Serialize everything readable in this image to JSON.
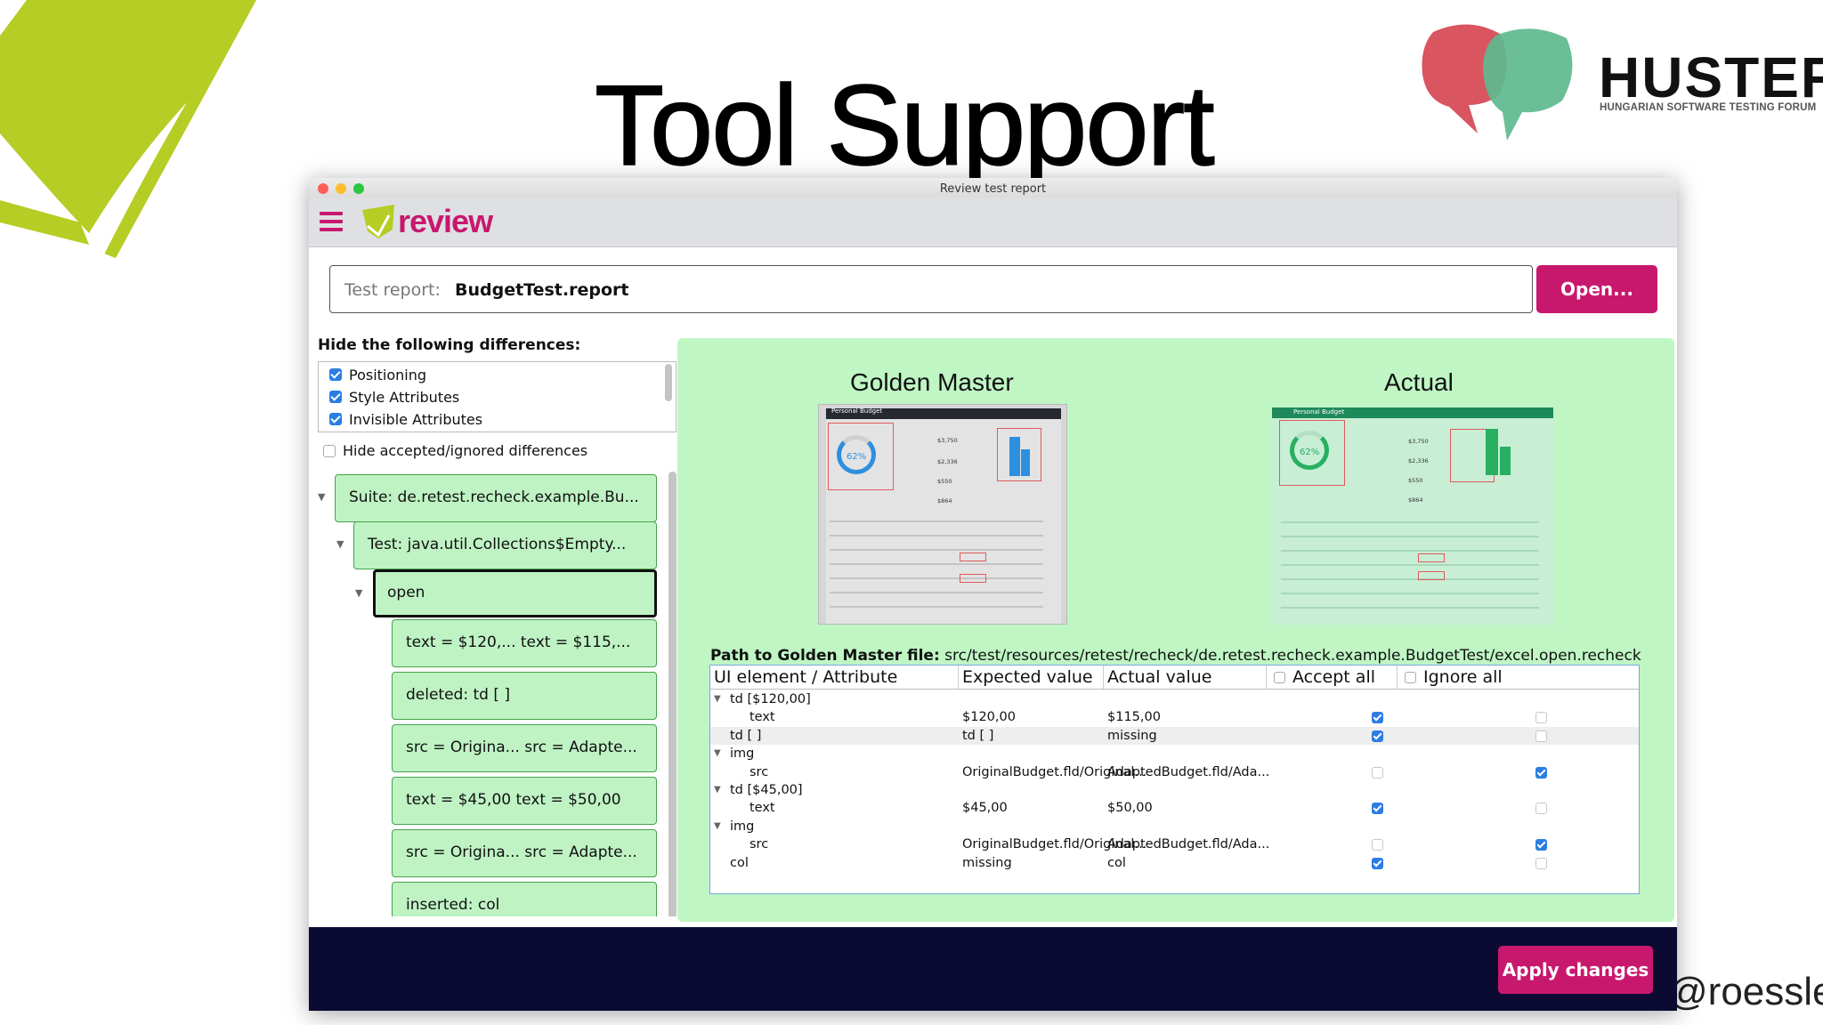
{
  "slide": {
    "title": "Tool Support",
    "handle": "@roesslerj",
    "brand": {
      "name": "HUSTEF",
      "subtitle": "HUNGARIAN SOFTWARE TESTING FORUM"
    }
  },
  "app": {
    "window_title": "Review test report",
    "logo_text": "review",
    "report_field": {
      "label": "Test report:",
      "value": "BudgetTest.report"
    },
    "open_button": "Open...",
    "hide_heading": "Hide the following differences:",
    "filters": [
      {
        "label": "Positioning",
        "checked": true
      },
      {
        "label": "Style Attributes",
        "checked": true
      },
      {
        "label": "Invisible Attributes",
        "checked": true
      }
    ],
    "hide_accepted": {
      "label": "Hide accepted/ignored differences",
      "checked": false
    },
    "tree": {
      "suite": "Suite: de.retest.recheck.example.Bu...",
      "test": "Test:  java.util.Collections$Empty...",
      "step": "open",
      "diffs": [
        "text = $120,...   text = $115,...",
        "deleted: td [ ]",
        "src = Origina...   src = Adapte...",
        "text = $45,00     text = $50,00",
        "src = Origina...   src = Adapte...",
        "inserted: col"
      ]
    },
    "golden_master_title": "Golden Master",
    "actual_title": "Actual",
    "path": {
      "label": "Path to Golden Master file:",
      "value": "src/test/resources/retest/recheck/de.retest.recheck.example.BudgetTest/excel.open.recheck"
    },
    "table": {
      "headers": [
        "UI element / Attribute",
        "Expected value",
        "Actual value",
        "Accept all",
        "Ignore all"
      ],
      "rows": [
        {
          "level": 0,
          "expand": true,
          "element": "td [$120,00]",
          "expected": "",
          "actual": "",
          "accept": null,
          "ignore": null
        },
        {
          "level": 1,
          "expand": false,
          "element": "text",
          "expected": "$120,00",
          "actual": "$115,00",
          "accept": true,
          "ignore": false
        },
        {
          "level": 0,
          "expand": false,
          "element": "td [ ]",
          "expected": "td [ ]",
          "actual": "missing",
          "accept": true,
          "ignore": false
        },
        {
          "level": 0,
          "expand": true,
          "element": "img",
          "expected": "",
          "actual": "",
          "accept": null,
          "ignore": null
        },
        {
          "level": 1,
          "expand": false,
          "element": "src",
          "expected": "OriginalBudget.fld/Original...",
          "actual": "AdaptedBudget.fld/Ada...",
          "accept": false,
          "ignore": true
        },
        {
          "level": 0,
          "expand": true,
          "element": "td [$45,00]",
          "expected": "",
          "actual": "",
          "accept": null,
          "ignore": null
        },
        {
          "level": 1,
          "expand": false,
          "element": "text",
          "expected": "$45,00",
          "actual": "$50,00",
          "accept": true,
          "ignore": false
        },
        {
          "level": 0,
          "expand": true,
          "element": "img",
          "expected": "",
          "actual": "",
          "accept": null,
          "ignore": null
        },
        {
          "level": 1,
          "expand": false,
          "element": "src",
          "expected": "OriginalBudget.fld/Original...",
          "actual": "AdaptedBudget.fld/Ada...",
          "accept": false,
          "ignore": true
        },
        {
          "level": 0,
          "expand": false,
          "element": "col",
          "expected": "missing",
          "actual": "col",
          "accept": true,
          "ignore": false
        }
      ]
    },
    "shot_text": {
      "title": "Personal Budget",
      "percent": "62%",
      "values": [
        "$3,750",
        "$2,336",
        "$550",
        "$864"
      ]
    },
    "apply_button": "Apply changes"
  },
  "colors": {
    "accent": "#c8186e",
    "tree_node": "#bff3c4",
    "panel": "#bff6c4",
    "checkbox": "#2b7de3",
    "footer": "#0a0a32",
    "logo_green": "#b5cd25"
  }
}
